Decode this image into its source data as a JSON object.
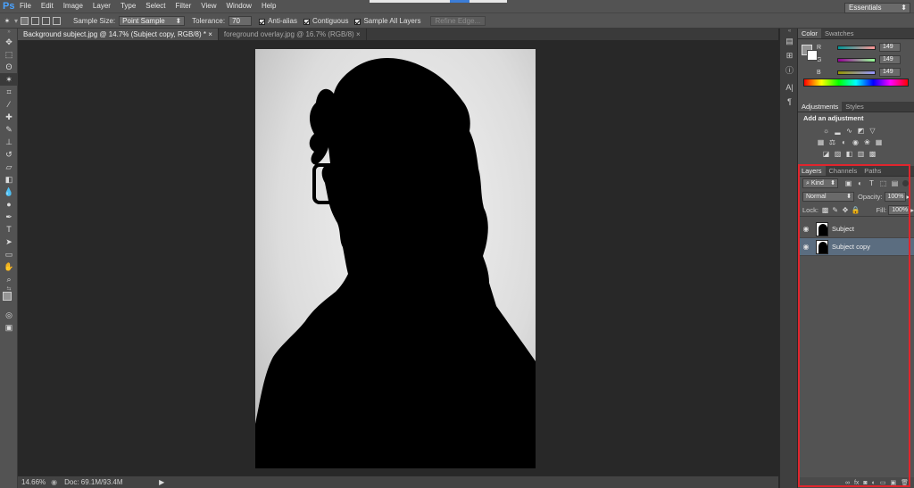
{
  "app": {
    "logo": "Ps"
  },
  "menu": [
    "File",
    "Edit",
    "Image",
    "Layer",
    "Type",
    "Select",
    "Filter",
    "View",
    "Window",
    "Help"
  ],
  "options": {
    "sample_size_label": "Sample Size:",
    "sample_size_value": "Point Sample",
    "tolerance_label": "Tolerance:",
    "tolerance_value": "70",
    "anti_alias": "Anti-alias",
    "contiguous": "Contiguous",
    "sample_all_layers": "Sample All Layers",
    "refine_edge": "Refine Edge...",
    "workspace": "Essentials"
  },
  "tabs": [
    {
      "label": "Background subject.jpg @ 14.7% (Subject copy, RGB/8) *",
      "close": "×"
    },
    {
      "label": "foreground overlay.jpg @ 16.7% (RGB/8)",
      "close": "×"
    }
  ],
  "status": {
    "zoom": "14.66%",
    "doc": "Doc: 69.1M/93.4M"
  },
  "color_panel": {
    "tabs": [
      "Color",
      "Swatches"
    ],
    "r": {
      "label": "R",
      "value": "149"
    },
    "g": {
      "label": "G",
      "value": "149"
    },
    "b": {
      "label": "B",
      "value": "149"
    }
  },
  "adjustments_panel": {
    "tabs": [
      "Adjustments",
      "Styles"
    ],
    "heading": "Add an adjustment"
  },
  "layers_panel": {
    "tabs": [
      "Layers",
      "Channels",
      "Paths"
    ],
    "kind_filter": "Kind",
    "blend_mode": "Normal",
    "opacity_label": "Opacity:",
    "opacity_value": "100%",
    "lock_label": "Lock:",
    "fill_label": "Fill:",
    "fill_value": "100%",
    "layers": [
      {
        "name": "Subject",
        "selected": false
      },
      {
        "name": "Subject copy",
        "selected": true
      }
    ]
  },
  "colors": {
    "highlight": "#e0252d",
    "selected_layer": "#5b6d80"
  }
}
